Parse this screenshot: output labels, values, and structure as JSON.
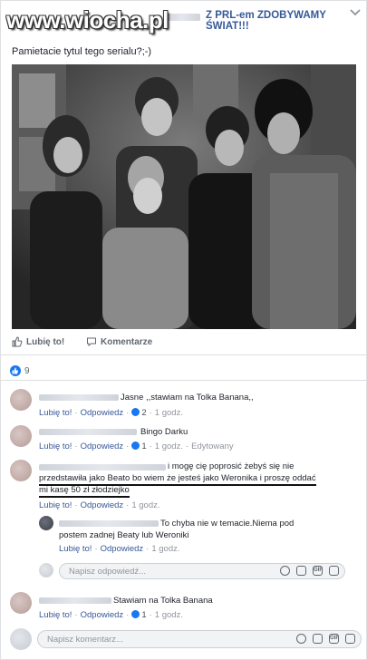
{
  "watermark": "www.wiocha.pl",
  "post": {
    "group_name": "Z PRL-em ZDOBYWAMY ŚWIAT!!!",
    "text": "Pamietacie tytul tego serialu?;-)",
    "actions": {
      "like": "Lubię to!",
      "comment": "Komentarze"
    },
    "reaction_count": "9"
  },
  "comments": [
    {
      "text": "Jasne ,,stawiam na Tolka Banana,,",
      "like": "Lubię to!",
      "reply": "Odpowiedz",
      "likes": "2",
      "time": "1 godz."
    },
    {
      "text": "Bingo Darku",
      "like": "Lubię to!",
      "reply": "Odpowiedz",
      "likes": "1",
      "time": "1 godz.",
      "edited": "Edytowany"
    },
    {
      "line1": "i mogę cię poprosić żebyś się nie",
      "line2": "przedstawiła jako Beato bo wiem że jesteś jako Weronika i proszę oddać",
      "line3": "mi kasę 50 zł złodziejko",
      "like": "Lubię to!",
      "reply": "Odpowiedz",
      "time": "1 godz."
    },
    {
      "line1": "To chyba nie w temacie.Niema pod",
      "line2": "postem zadnej Beaty lub Weroniki",
      "like": "Lubię to!",
      "reply": "Odpowiedz",
      "time": "1 godz."
    },
    {
      "text": "Stawiam na Tolka Banana",
      "like": "Lubię to!",
      "reply": "Odpowiedz",
      "likes": "1",
      "time": "1 godz."
    }
  ],
  "reply_placeholder": "Napisz odpowiedź...",
  "comment_placeholder": "Napisz komentarz...",
  "colors": {
    "link": "#385898",
    "brand": "#1877f2"
  }
}
